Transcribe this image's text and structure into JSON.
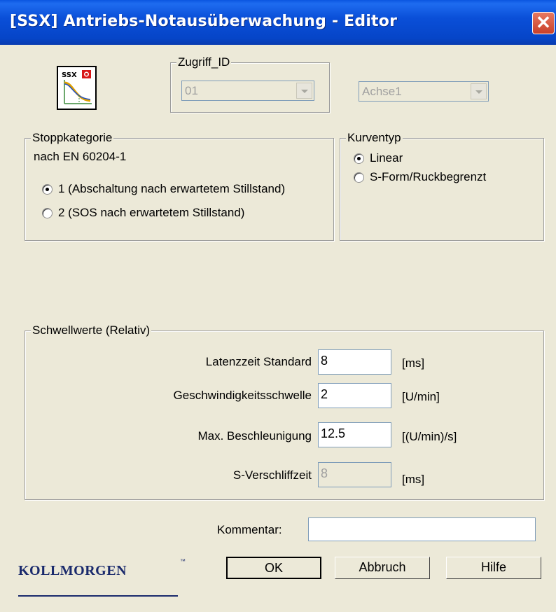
{
  "window": {
    "title": "[SSX] Antriebs-Notausüberwachung - Editor",
    "close_glyph": "✕"
  },
  "icon": {
    "badge": "SSX"
  },
  "zugriff": {
    "label": "Zugriff_ID",
    "id_value": "01",
    "axis_value": "Achse1"
  },
  "stoppkategorie": {
    "label": "Stoppkategorie",
    "norm": "nach EN 60204-1",
    "options": [
      {
        "label": "1 (Abschaltung nach erwartetem Stillstand)",
        "checked": true
      },
      {
        "label": "2 (SOS nach erwartetem Stillstand)",
        "checked": false
      }
    ]
  },
  "kurventyp": {
    "label": "Kurventyp",
    "options": [
      {
        "label": "Linear",
        "checked": true
      },
      {
        "label": "S-Form/Ruckbegrenzt",
        "checked": false
      }
    ]
  },
  "schwellwerte": {
    "label": "Schwellwerte (Relativ)",
    "rows": [
      {
        "label": "Latenzzeit Standard",
        "value": "8",
        "unit": "[ms]",
        "enabled": true
      },
      {
        "label": "Geschwindigkeitsschwelle",
        "value": "2",
        "unit": "[U/min]",
        "enabled": true
      },
      {
        "label": "Max. Beschleunigung",
        "value": "12.5",
        "unit": "[(U/min)/s]",
        "enabled": true
      },
      {
        "label": "S-Verschliffzeit",
        "value": "8",
        "unit": "[ms]",
        "enabled": false
      }
    ]
  },
  "kommentar": {
    "label": "Kommentar:",
    "value": ""
  },
  "buttons": {
    "ok": "OK",
    "cancel": "Abbruch",
    "help": "Hilfe"
  },
  "logo": {
    "text": "KOLLMORGEN",
    "tm": "™"
  },
  "colors": {
    "titlebar": "#0a4fd8",
    "dialog_bg": "#ece9d8",
    "logo": "#1a2a6c"
  }
}
